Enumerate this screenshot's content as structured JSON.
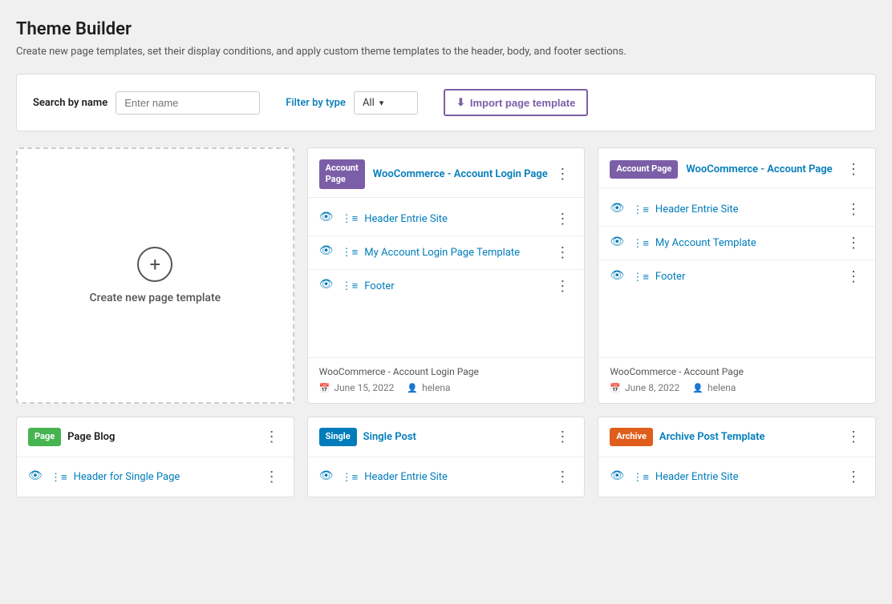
{
  "page": {
    "title": "Theme Builder",
    "subtitle": "Create new page templates, set their display conditions, and apply custom theme templates to the header, body, and footer sections."
  },
  "filterBar": {
    "searchLabel": "Search by name",
    "searchPlaceholder": "Enter name",
    "filterLabel": "Filter",
    "filterLabelBy": "by type",
    "filterValue": "All",
    "importBtn": "Import page template"
  },
  "createCard": {
    "plusIcon": "+",
    "label": "Create new page template"
  },
  "cards": [
    {
      "id": "woo-account-login",
      "badgeText": "Account\nPage",
      "badgeClass": "badge-account",
      "title": "WooCommerce - Account Login Page",
      "items": [
        {
          "name": "Header Entrie Site"
        },
        {
          "name": "My Account Login Page Template"
        },
        {
          "name": "Footer"
        }
      ],
      "footerTitle": "WooCommerce - Account Login Page",
      "date": "June 15, 2022",
      "author": "helena"
    },
    {
      "id": "woo-account-page",
      "badgeText": "Account Page",
      "badgeClass": "badge-account",
      "title": "WooCommerce - Account Page",
      "items": [
        {
          "name": "Header Entrie Site"
        },
        {
          "name": "My Account Template"
        },
        {
          "name": "Footer"
        }
      ],
      "footerTitle": "WooCommerce - Account Page",
      "date": "June 8, 2022",
      "author": "helena"
    }
  ],
  "bottomCards": [
    {
      "id": "page-blog",
      "badgeText": "Page",
      "badgeClass": "badge-page",
      "title": "Page  Blog",
      "items": [
        {
          "name": "Header for Single Page"
        }
      ]
    },
    {
      "id": "single-post",
      "badgeText": "Single",
      "badgeClass": "badge-single",
      "title": "Single Post",
      "items": [
        {
          "name": "Header Entrie Site"
        }
      ]
    },
    {
      "id": "archive-post",
      "badgeText": "Archive",
      "badgeClass": "badge-archive",
      "title": "Archive Post Template",
      "items": [
        {
          "name": "Header Entrie Site"
        }
      ]
    }
  ],
  "icons": {
    "threeDots": "⋮",
    "eye": "👁",
    "editorLines": "≡",
    "download": "⬇",
    "calendar": "📅",
    "user": "👤",
    "plus": "+"
  }
}
